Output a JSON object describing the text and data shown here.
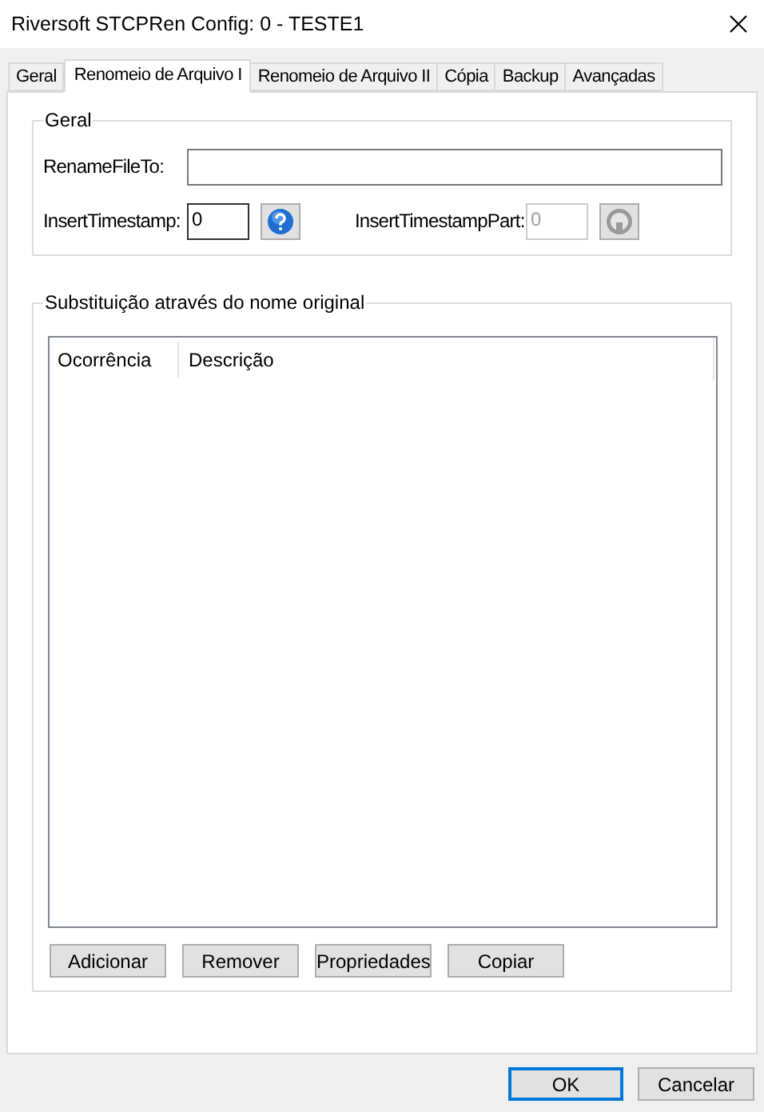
{
  "window": {
    "title": "Riversoft STCPRen Config: 0 - TESTE1"
  },
  "tabs": [
    {
      "label": "Geral",
      "selected": false
    },
    {
      "label": "Renomeio de Arquivo I",
      "selected": true
    },
    {
      "label": "Renomeio de Arquivo II",
      "selected": false
    },
    {
      "label": "Cópia",
      "selected": false
    },
    {
      "label": "Backup",
      "selected": false
    },
    {
      "label": "Avançadas",
      "selected": false
    }
  ],
  "general_group": {
    "title": "Geral",
    "rename_file_to": {
      "label": "RenameFileTo:"
    },
    "insert_timestamp": {
      "label": "InsertTimestamp:",
      "value": "0",
      "disabled": false,
      "help_disabled": false
    },
    "insert_timestamp_part": {
      "label": "InsertTimestampPart:",
      "value": "0",
      "disabled": true,
      "help_disabled": true
    }
  },
  "substitution_group": {
    "title": "Substituição através do nome original",
    "columns": [
      "Ocorrência",
      "Descrição"
    ],
    "buttons": [
      "Adicionar",
      "Remover",
      "Propriedades",
      "Copiar"
    ]
  },
  "dialog_buttons": [
    {
      "label": "OK",
      "focused": true
    },
    {
      "label": "Cancelar",
      "focused": false
    }
  ]
}
